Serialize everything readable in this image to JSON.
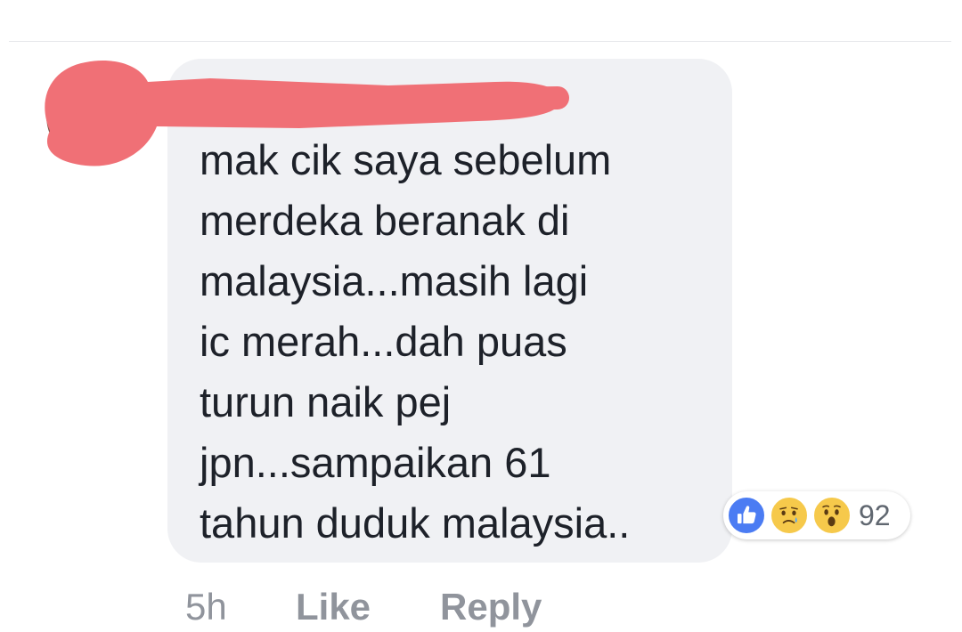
{
  "comment": {
    "author_name": "",
    "text_lines": [
      "mak cik saya sebelum",
      "merdeka beranak di",
      "malaysia...masih lagi",
      "ic merah...dah puas",
      "turun naik pej",
      "jpn...sampaikan 61",
      "tahun duduk malaysia.."
    ],
    "timestamp": "5h",
    "like_label": "Like",
    "reply_label": "Reply",
    "reactions": {
      "icons": [
        "like-icon",
        "sad-icon",
        "wow-icon"
      ],
      "count": "92"
    }
  },
  "colors": {
    "bubble_background": "#f0f1f4",
    "text": "#1d2129",
    "meta_text": "#90949c",
    "like_blue": "#4b7cf3",
    "emoji_yellow": "#f6c94b",
    "redaction": "#f07076"
  }
}
